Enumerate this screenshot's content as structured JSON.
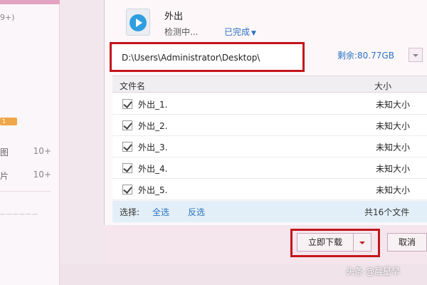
{
  "left": {
    "count": "9+)",
    "badge": "1",
    "items": [
      {
        "label": "图",
        "count": "10+"
      },
      {
        "label": "片",
        "count": "10+"
      }
    ],
    "footer": "——————"
  },
  "task": {
    "name": "外出",
    "status": "检测中...",
    "done_label": "已完成",
    "icon": "video-file-icon"
  },
  "path": {
    "value": "D:\\Users\\Administrator\\Desktop\\",
    "free_space": "剩余:80.77GB"
  },
  "table": {
    "headers": {
      "name": "文件名",
      "size": "大小"
    },
    "rows": [
      {
        "name": "外出_1.",
        "size": "未知大小",
        "checked": true
      },
      {
        "name": "外出_2.",
        "size": "未知大小",
        "checked": true
      },
      {
        "name": "外出_3.",
        "size": "未知大小",
        "checked": true
      },
      {
        "name": "外出_4.",
        "size": "未知大小",
        "checked": true
      },
      {
        "name": "外出_5.",
        "size": "未知大小",
        "checked": true
      }
    ]
  },
  "selection": {
    "label": "选择:",
    "all": "全选",
    "invert": "反选",
    "count": "共16个文件"
  },
  "actions": {
    "download_now": "立即下载",
    "cancel": "取消"
  },
  "watermark": "头条 @晨星早",
  "colors": {
    "highlight": "#c3161c",
    "link": "#2b72c4",
    "accent": "#e3a2c0"
  }
}
